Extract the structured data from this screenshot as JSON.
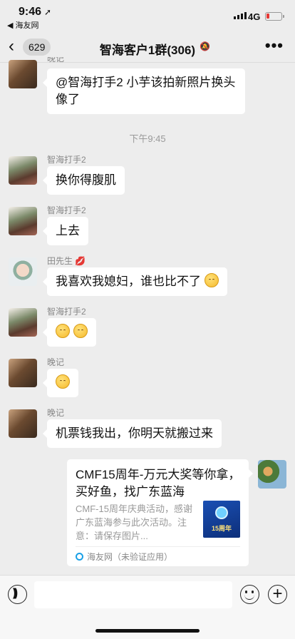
{
  "status": {
    "time": "9:46",
    "back_app": "◀ 海友网",
    "network": "4G"
  },
  "nav": {
    "unread_count": "629",
    "title": "智海客户1群(306)",
    "more": "•••"
  },
  "messages": [
    {
      "sender": "晚记",
      "text": "@智海打手2 小芋该拍新照片换头像了"
    },
    {
      "sender": "智海打手2",
      "text": "换你得腹肌"
    },
    {
      "sender": "智海打手2",
      "text": "上去"
    },
    {
      "sender": "田先生",
      "text": "我喜欢我媳妇，谁也比不了"
    },
    {
      "sender": "智海打手2",
      "text": ""
    },
    {
      "sender": "晚记",
      "text": ""
    },
    {
      "sender": "晚记",
      "text": "机票钱我出，你明天就搬过来"
    }
  ],
  "time_separator": "下午9:45",
  "card": {
    "title": "CMF15周年-万元大奖等你拿，买好鱼，找广东蓝海",
    "description": "CMF-15周年庆典活动，感谢广东蓝海参与此次活动。注意：请保存图片...",
    "thumb_text": "15周年",
    "source": "海友网（未验证应用）"
  },
  "icons": {
    "back": "chevron-left-icon",
    "mute": "bell-slash-icon",
    "more": "ellipsis-icon",
    "voice": "voice-icon",
    "emoji": "emoji-icon",
    "plus": "plus-icon"
  },
  "colors": {
    "background": "#ededed",
    "bubble": "#ffffff",
    "battery_low": "#e53935"
  }
}
